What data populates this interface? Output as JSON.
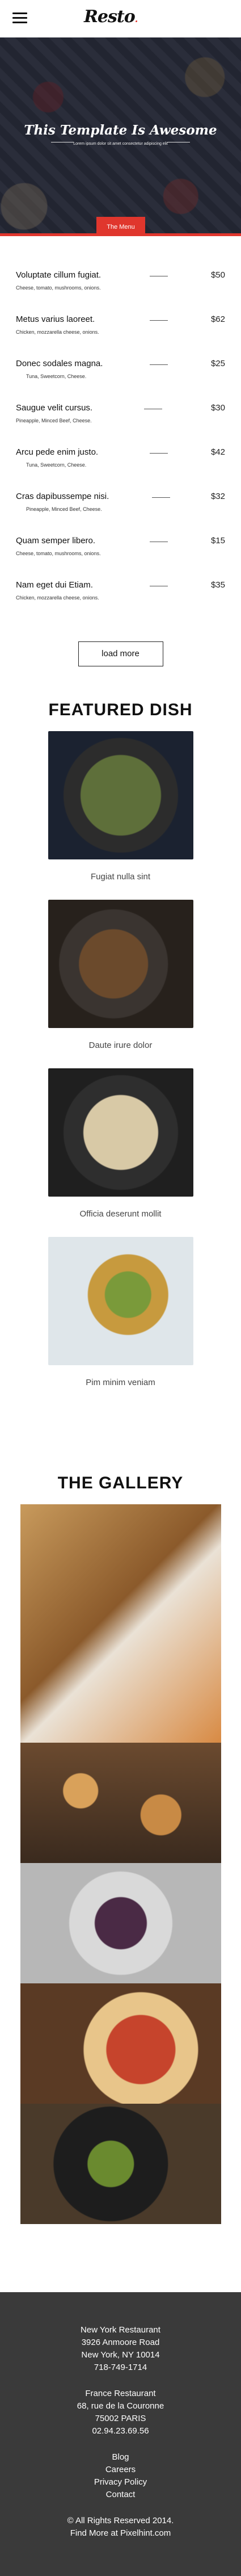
{
  "header": {
    "logo": "Resto",
    "logo_dot": "."
  },
  "hero": {
    "title": "This Template Is Awesome",
    "subtitle": "Lorem ipsum dolor sit amet consectetur adipiscing elit",
    "menu_tab": "The Menu"
  },
  "menu": {
    "items": [
      {
        "name": "Voluptate cillum fugiat.",
        "desc": "Cheese, tomato, mushrooms, onions.",
        "price": "$50"
      },
      {
        "name": "Metus varius laoreet.",
        "desc": "Chicken, mozzarella cheese, onions.",
        "price": "$62"
      },
      {
        "name": "Donec sodales magna.",
        "desc": "Tuna, Sweetcorn, Cheese.",
        "price": "$25"
      },
      {
        "name": "Saugue velit cursus.",
        "desc": "Pineapple, Minced Beef, Cheese.",
        "price": "$30"
      },
      {
        "name": "Arcu pede enim justo.",
        "desc": "Tuna, Sweetcorn, Cheese.",
        "price": "$42"
      },
      {
        "name": "Cras dapibussempe nisi.",
        "desc": "Pineapple, Minced Beef, Cheese.",
        "price": "$32"
      },
      {
        "name": "Quam semper libero.",
        "desc": "Cheese, tomato, mushrooms, onions.",
        "price": "$15"
      },
      {
        "name": "Nam eget dui Etiam.",
        "desc": "Chicken, mozzarella cheese, onions.",
        "price": "$35"
      }
    ],
    "load_more": "load more"
  },
  "featured": {
    "title": "FEATURED DISH",
    "dishes": [
      {
        "caption": "Fugiat nulla sint"
      },
      {
        "caption": "Daute irure dolor"
      },
      {
        "caption": "Officia deserunt mollit"
      },
      {
        "caption": "Pim minim veniam"
      }
    ]
  },
  "gallery": {
    "title": "THE GALLERY"
  },
  "footer": {
    "ny": {
      "name": "New York Restaurant",
      "street": "3926 Anmoore Road",
      "city": "New York, NY 10014",
      "phone": "718-749-1714"
    },
    "fr": {
      "name": "France Restaurant",
      "street": "68, rue de la Couronne",
      "city": "75002 PARIS",
      "phone": "02.94.23.69.56"
    },
    "links": [
      "Blog",
      "Careers",
      "Privacy Policy",
      "Contact"
    ],
    "copyright": "© All Rights Reserved 2014.",
    "credit": "Find More at Pixelhint.com"
  }
}
